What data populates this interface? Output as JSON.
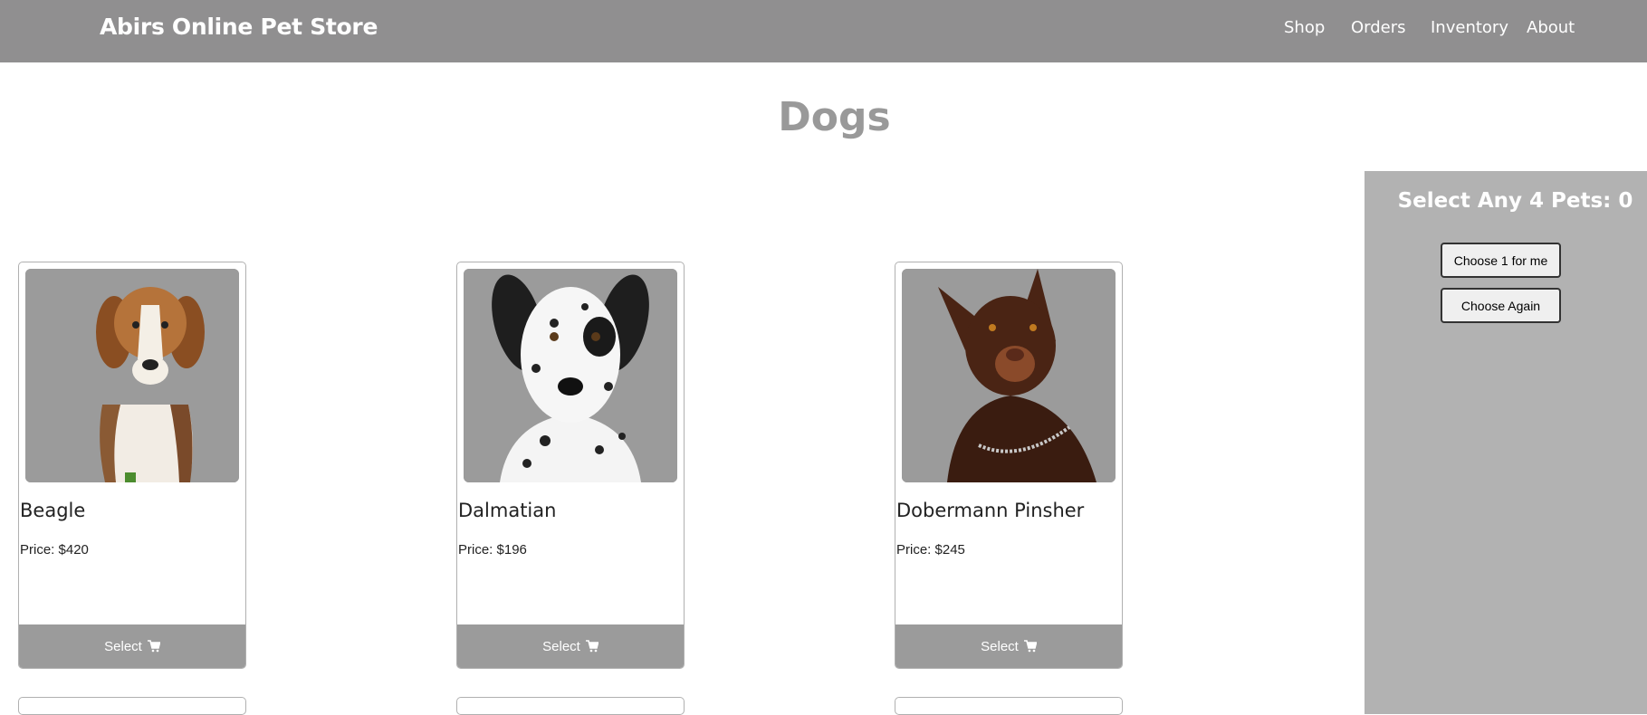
{
  "navbar": {
    "brand": "Abirs Online Pet Store",
    "links": [
      {
        "label": "Shop"
      },
      {
        "label": "Orders"
      },
      {
        "label": "Inventory"
      },
      {
        "label": "About"
      }
    ]
  },
  "page": {
    "title": "Dogs"
  },
  "side_panel": {
    "title_prefix": "Select Any 4 Pets: ",
    "count": "0",
    "choose_one_label": "Choose 1 for me",
    "choose_again_label": "Choose Again"
  },
  "products": [
    {
      "name": "Beagle",
      "price_label": "Price: ",
      "price": "$420",
      "select_label": "Select",
      "icon": "cart-icon"
    },
    {
      "name": "Dalmatian",
      "price_label": "Price: ",
      "price": "$196",
      "select_label": "Select",
      "icon": "cart-icon"
    },
    {
      "name": "Dobermann Pinsher",
      "price_label": "Price: ",
      "price": "$245",
      "select_label": "Select",
      "icon": "cart-icon"
    }
  ],
  "colors": {
    "navbar_bg": "#908f90",
    "panel_bg": "#b2b2b2",
    "card_button_bg": "#9b9b9b",
    "title_color": "#999999"
  }
}
